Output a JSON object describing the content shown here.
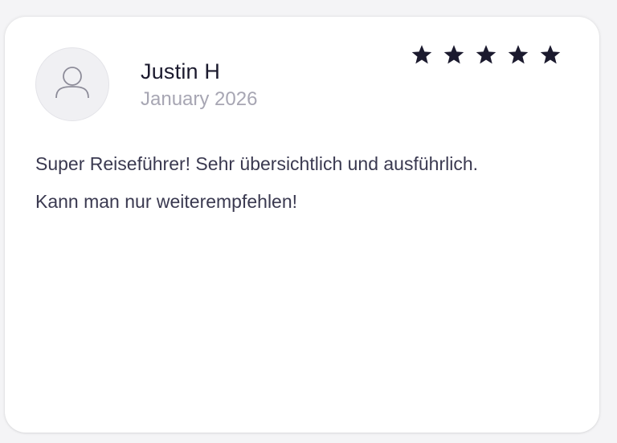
{
  "review": {
    "author_name": "Justin H",
    "date": "January 2026",
    "rating": 5,
    "rating_max": 5,
    "text_lines": [
      "Super Reiseführer! Sehr übersichtlich und ausführlich.",
      "Kann man nur weiterempfehlen!"
    ],
    "avatar_icon": "user-placeholder-icon",
    "star_icon": "star-icon"
  },
  "colors": {
    "star": "#1b1a2e",
    "name": "#1b1a2e",
    "date": "#a7a6b3",
    "text": "#3a3950"
  }
}
